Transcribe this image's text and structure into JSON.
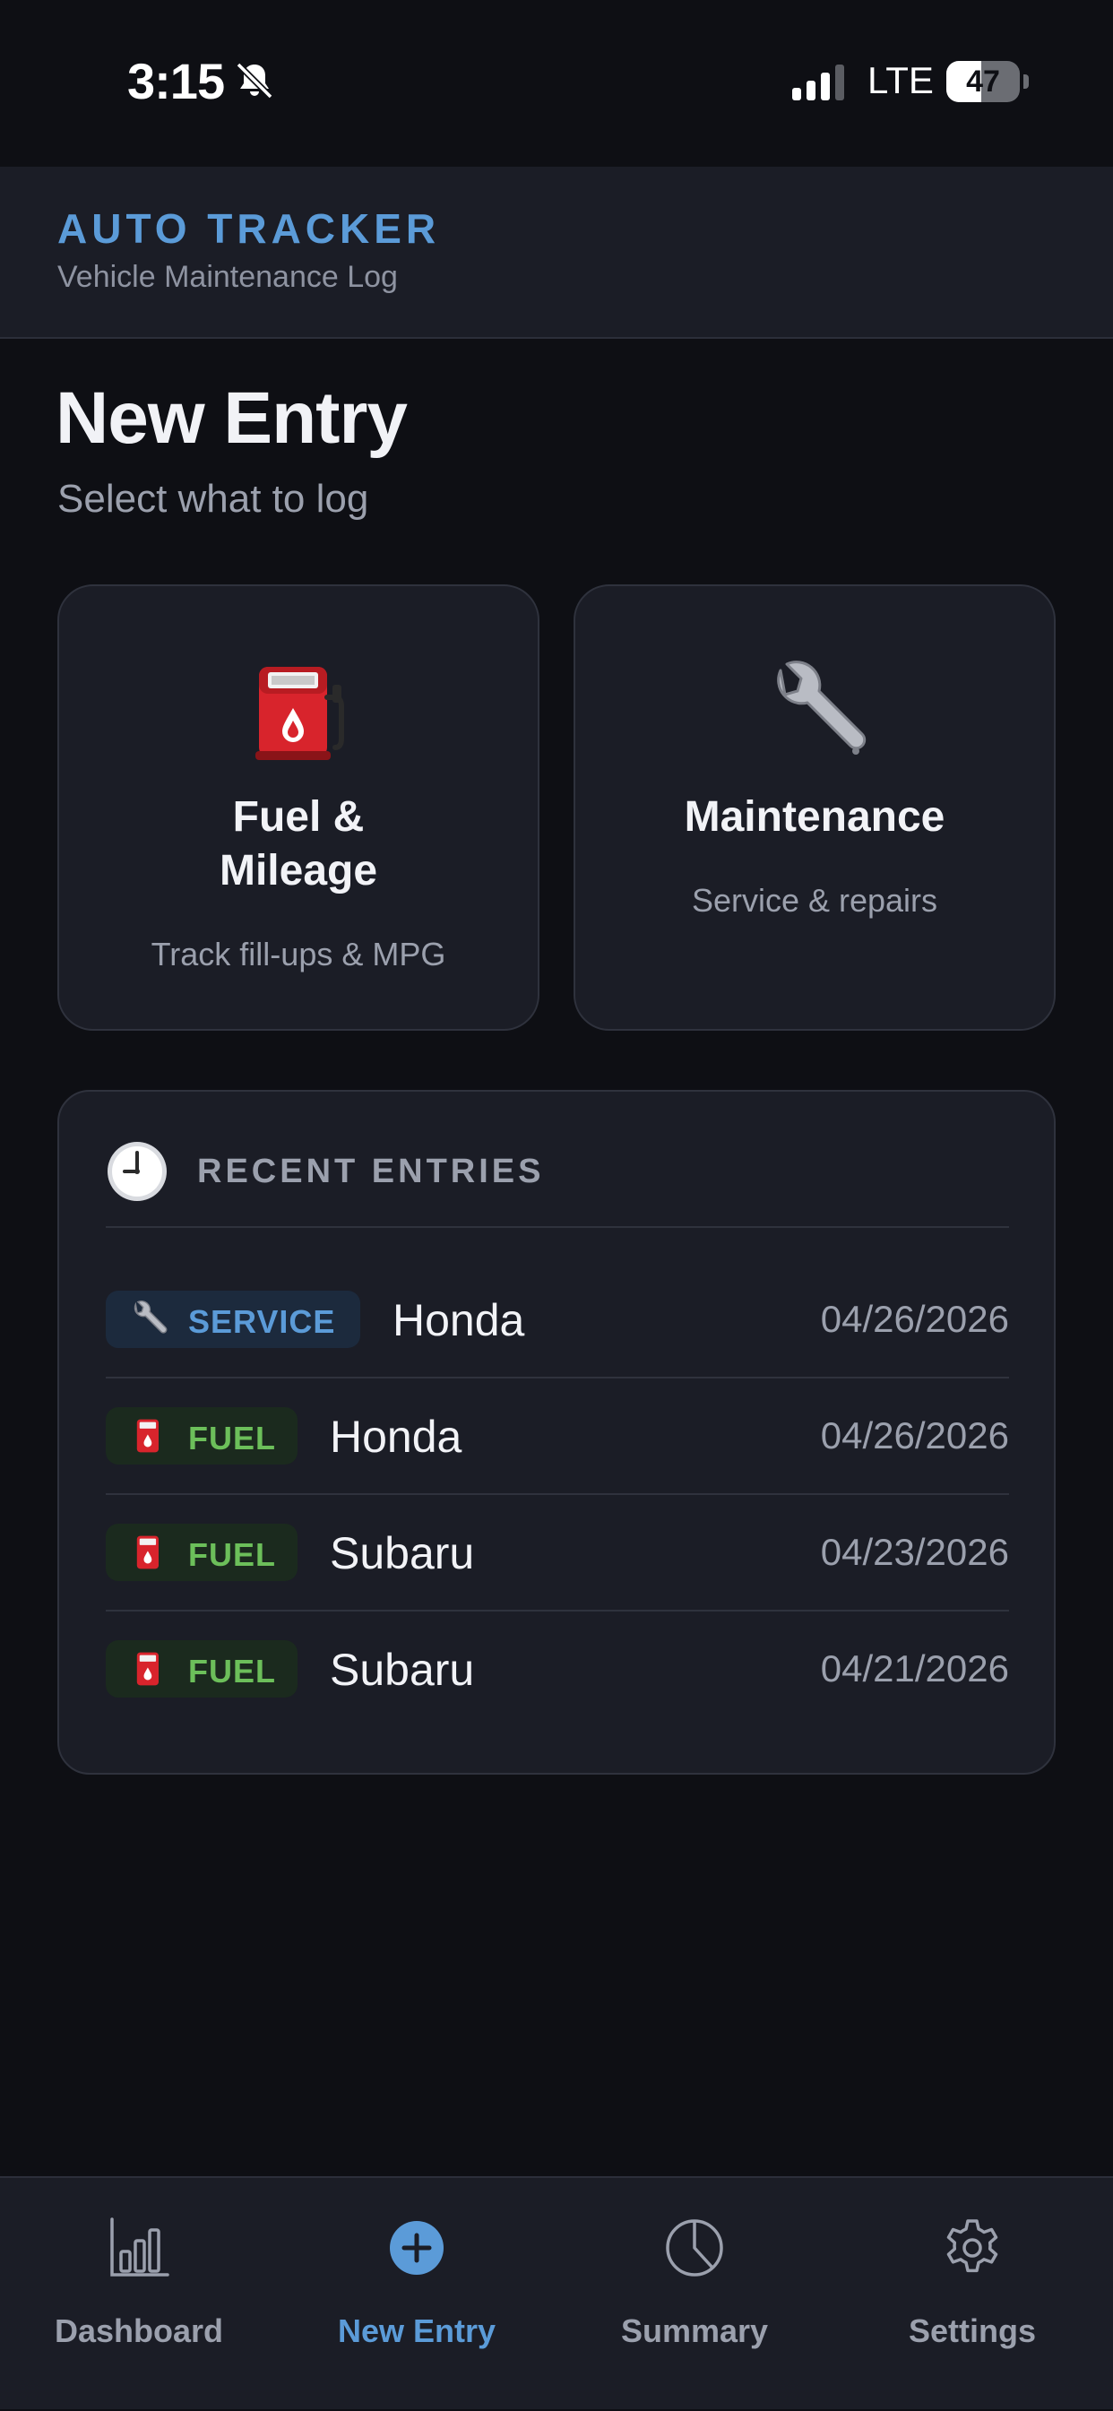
{
  "status_bar": {
    "time": "3:15",
    "network": "LTE",
    "battery_percent": "47",
    "battery_level": 0.47
  },
  "header": {
    "title": "AUTO TRACKER",
    "subtitle": "Vehicle Maintenance Log"
  },
  "page": {
    "title": "New Entry",
    "subtitle": "Select what to log"
  },
  "cards": [
    {
      "icon": "fuel-pump-icon",
      "title_line1": "Fuel &",
      "title_line2": "Mileage",
      "description": "Track fill-ups & MPG"
    },
    {
      "icon": "wrench-icon",
      "title": "Maintenance",
      "description": "Service & repairs"
    }
  ],
  "recent": {
    "title": "RECENT ENTRIES",
    "entries": [
      {
        "type": "SERVICE",
        "icon": "wrench-icon",
        "vehicle": "Honda",
        "date": "04/26/2026"
      },
      {
        "type": "FUEL",
        "icon": "fuel-pump-icon",
        "vehicle": "Honda",
        "date": "04/26/2026"
      },
      {
        "type": "FUEL",
        "icon": "fuel-pump-icon",
        "vehicle": "Subaru",
        "date": "04/23/2026"
      },
      {
        "type": "FUEL",
        "icon": "fuel-pump-icon",
        "vehicle": "Subaru",
        "date": "04/21/2026"
      }
    ]
  },
  "tabs": [
    {
      "label": "Dashboard",
      "icon": "bar-chart-icon",
      "active": false
    },
    {
      "label": "New Entry",
      "icon": "plus-circle-icon",
      "active": true
    },
    {
      "label": "Summary",
      "icon": "pie-chart-icon",
      "active": false
    },
    {
      "label": "Settings",
      "icon": "gear-icon",
      "active": false
    }
  ],
  "colors": {
    "accent": "#5b9bd8",
    "fuel_green": "#6cbf5a",
    "background": "#0e0f14",
    "surface": "#1b1d26"
  }
}
